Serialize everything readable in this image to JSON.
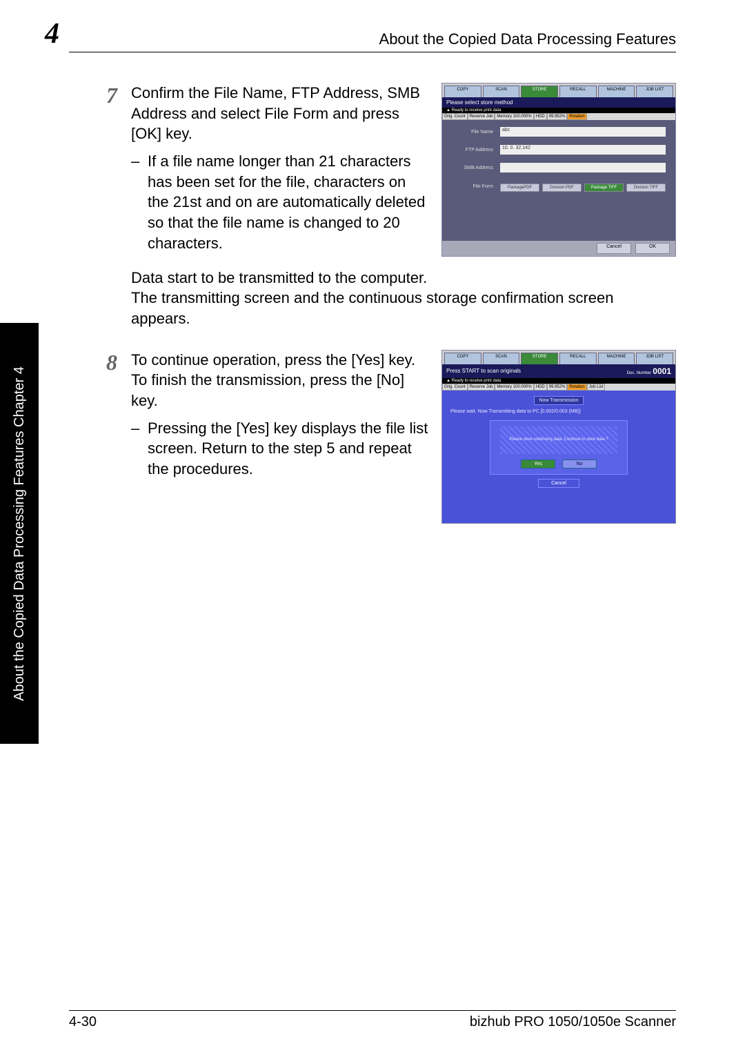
{
  "header": {
    "chapter_num": "4",
    "title": "About the Copied Data Processing Features"
  },
  "side_tab": "About the Copied Data Processing Features    Chapter 4",
  "step7": {
    "num": "7",
    "intro": "Confirm the File Name, FTP Address, SMB Address and select File Form and press [OK] key.",
    "bullet": "If a file name longer than 21 characters has been set for the file,  characters on the 21st and on are automatically deleted so that the file name is changed to 20 characters.",
    "follow1": "Data start to be transmitted to the computer.",
    "follow2": "The transmitting screen and the continuous storage confirmation screen appears."
  },
  "step8": {
    "num": "8",
    "intro": "To continue operation, press the [Yes] key. To finish the transmission, press the [No] key.",
    "bullet": "Pressing the [Yes] key displays the file list screen. Return to the step 5 and repeat the procedures."
  },
  "screenshot1": {
    "tabs": [
      "COPY",
      "SCAN",
      "STORE",
      "RECALL",
      "MACHINE",
      "JOB LIST"
    ],
    "banner": "Please select store method",
    "status_left": "Ready to receive print data",
    "status_items": [
      "Orig. Count",
      "Reserve Job",
      "Memory 100.000%",
      "HDD",
      "99.952%",
      "Rotation"
    ],
    "rows": {
      "file_name_label": "File Name",
      "file_name_value": "abc",
      "ftp_label": "FTP Address",
      "ftp_value": "10.  0. 32.142",
      "smb_label": "SMB Address",
      "smb_value": "",
      "fileform_label": "File Form"
    },
    "fileform_buttons": [
      "PackagePDF",
      "Division PDF",
      "Package TIFF",
      "Division TIFF"
    ],
    "footer": {
      "cancel": "Cancel",
      "ok": "OK"
    }
  },
  "screenshot2": {
    "tabs": [
      "COPY",
      "SCAN",
      "STORE",
      "RECALL",
      "MACHINE",
      "JOB LIST"
    ],
    "banner_left": "Press START to scan originals",
    "banner_right_label": "Doc. Number",
    "banner_right_value": "0001",
    "status_left": "Ready to receive print data",
    "status_items": [
      "Orig. Count",
      "Reserve Job",
      "Memory 100.000%",
      "HDD",
      "99.952%",
      "Rotation",
      "Job List"
    ],
    "bar": "Now Transmission",
    "msg": "Please wait. Now Transmitting data to PC\n[0.002/0.003 (MB)]",
    "panel_text": "Please store continuing data.\nContinue to store data ?",
    "yes": "Yes",
    "no": "No",
    "cancel": "Cancel"
  },
  "footer": {
    "left": "4-30",
    "right": "bizhub PRO 1050/1050e Scanner"
  }
}
